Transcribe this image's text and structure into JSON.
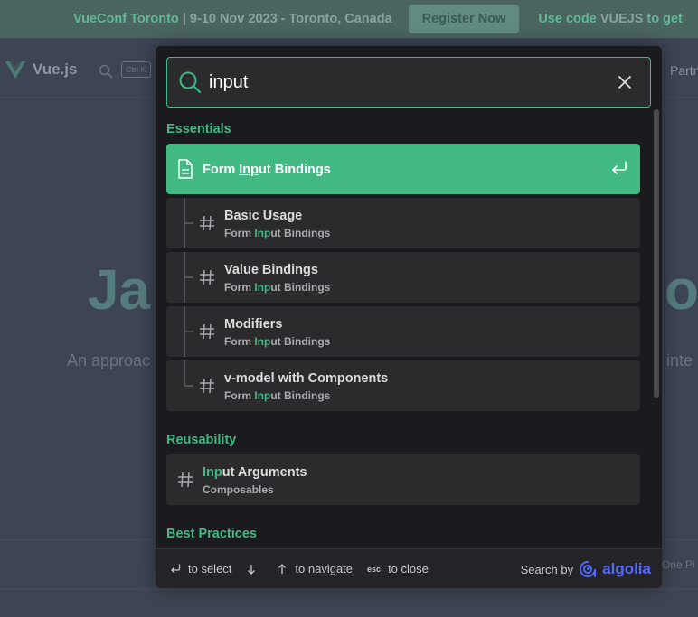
{
  "banner": {
    "event": "VueConf Toronto",
    "details": "9-10 Nov 2023 - Toronto, Canada",
    "register_label": "Register Now",
    "code_prefix": "Use code",
    "code": "VUEJS",
    "code_suffix": "to get"
  },
  "nav": {
    "brand": "Vue.js",
    "shortcut": "Ctrl K",
    "partial_right": "Partn"
  },
  "hero": {
    "left_fragment": "Ja",
    "right_fragment": "or",
    "tagline_left": "An approac",
    "tagline_right": "inte",
    "side_note": "One Pi"
  },
  "search": {
    "query": "input",
    "sections": [
      {
        "title": "Essentials",
        "hits": [
          {
            "kind": "page",
            "title": [
              "Form ",
              "Inp",
              "ut Bindings"
            ],
            "active": true
          },
          {
            "kind": "heading",
            "title": "Basic Usage",
            "path": [
              "Form ",
              "Inp",
              "ut Bindings"
            ]
          },
          {
            "kind": "heading",
            "title": "Value Bindings",
            "path": [
              "Form ",
              "Inp",
              "ut Bindings"
            ]
          },
          {
            "kind": "heading",
            "title": "Modifiers",
            "path": [
              "Form ",
              "Inp",
              "ut Bindings"
            ]
          },
          {
            "kind": "heading",
            "title": "v-model with Components",
            "path": [
              "Form ",
              "Inp",
              "ut Bindings"
            ],
            "last": true
          }
        ]
      },
      {
        "title": "Reusability",
        "hits": [
          {
            "kind": "top-heading",
            "title": [
              "",
              "Inp",
              "ut Arguments"
            ],
            "path": "Composables"
          }
        ]
      },
      {
        "title": "Best Practices",
        "hits": [
          {
            "kind": "page-partial",
            "title": ""
          }
        ]
      }
    ]
  },
  "footer": {
    "select_label": "to select",
    "navigate_label": "to navigate",
    "esc_key": "esc",
    "close_label": "to close",
    "search_by": "Search by",
    "provider": "algolia"
  },
  "colors": {
    "accent": "#42b883",
    "modal_bg": "#1b1b1f",
    "hit_bg": "#2b2b2e",
    "algolia": "#5468ff"
  }
}
